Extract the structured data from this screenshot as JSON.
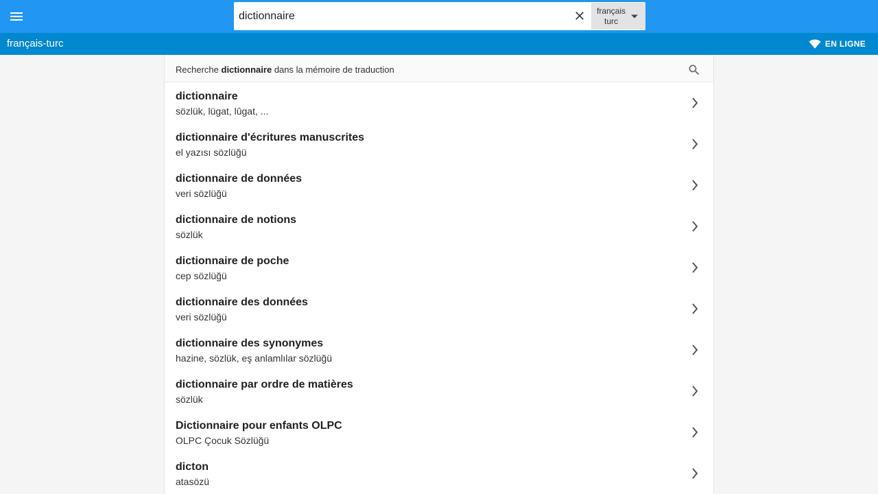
{
  "header": {
    "search_value": "dictionnaire",
    "lang_from": "français",
    "lang_to": "turc",
    "bar_color": "#2196f3"
  },
  "subheader": {
    "direction": "français-turc",
    "status": "EN LIGNE",
    "bar_color": "#0288d1"
  },
  "tm_search": {
    "prefix": "Recherche",
    "term": "dictionnaire",
    "suffix": "dans la mémoire de traduction"
  },
  "results": [
    {
      "term": "dictionnaire",
      "translation": "sözlük, lügat, lûgat, ..."
    },
    {
      "term": "dictionnaire d'écritures manuscrites",
      "translation": "el yazısı sözlüğü"
    },
    {
      "term": "dictionnaire de données",
      "translation": "veri sözlüğü"
    },
    {
      "term": "dictionnaire de notions",
      "translation": "sözlük"
    },
    {
      "term": "dictionnaire de poche",
      "translation": "cep sözlüğü"
    },
    {
      "term": "dictionnaire des données",
      "translation": "veri sözlüğü"
    },
    {
      "term": "dictionnaire des synonymes",
      "translation": "hazine, sözlük, eş anlamlılar sözlüğü"
    },
    {
      "term": "dictionnaire par ordre de matières",
      "translation": "sözlük"
    },
    {
      "term": "Dictionnaire pour enfants OLPC",
      "translation": "OLPC Çocuk Sözlüğü"
    },
    {
      "term": "dicton",
      "translation": "atasözü"
    }
  ]
}
